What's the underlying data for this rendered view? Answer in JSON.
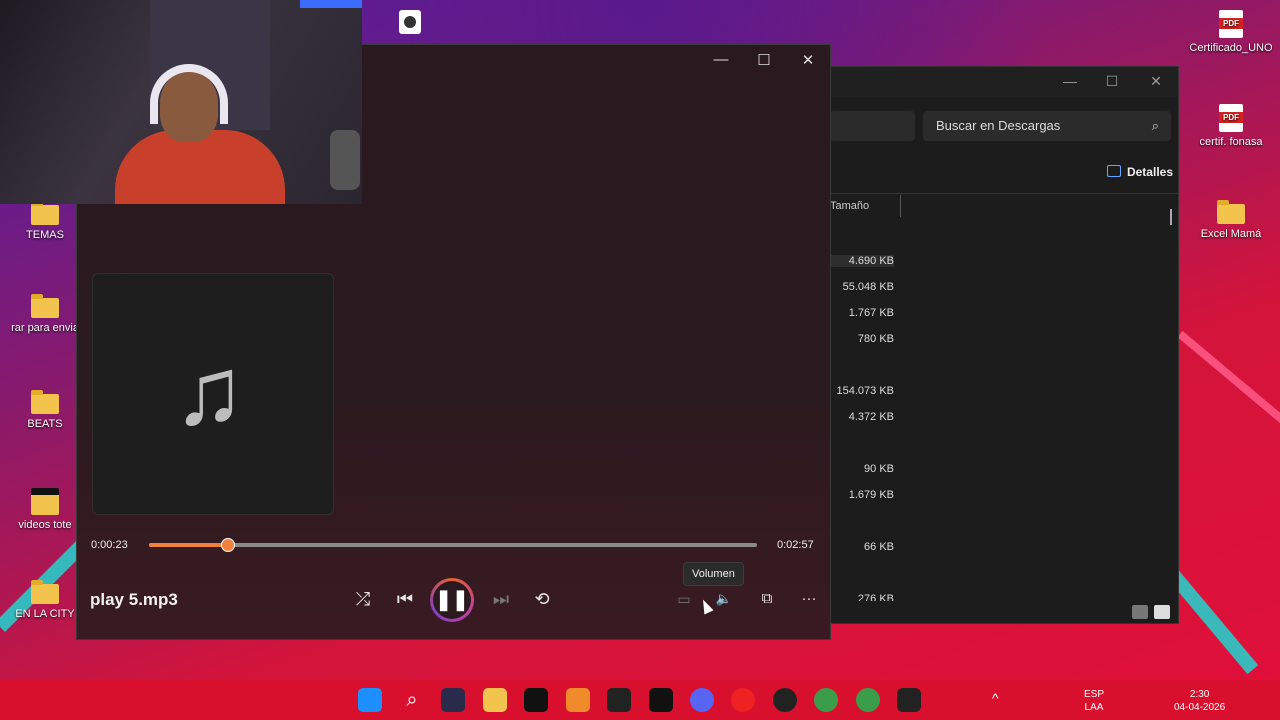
{
  "desktop": {
    "icons_left": [
      {
        "label": "TEMAS",
        "type": "folder"
      },
      {
        "label": "rar para envia",
        "type": "folder"
      },
      {
        "label": "BEATS",
        "type": "folder"
      },
      {
        "label": "videos tote",
        "type": "dark-folder"
      },
      {
        "label": "EN LA CITY",
        "type": "folder"
      }
    ],
    "icons_right": [
      {
        "label": "Certificado_UNO",
        "type": "pdf"
      },
      {
        "label": "certif. fonasa",
        "type": "pdf"
      },
      {
        "label": "Excel Mamá",
        "type": "folder"
      }
    ],
    "pdf_badge": "PDF"
  },
  "explorer": {
    "search_placeholder": "Buscar en Descargas",
    "details_label": "Detalles",
    "column_size": "Tamaño",
    "sizes": [
      "4.690 KB",
      "55.048 KB",
      "1.767 KB",
      "780 KB",
      "154.073 KB",
      "4.372 KB",
      "90 KB",
      "1.679 KB",
      "66 KB",
      "276 KB"
    ],
    "controls": {
      "minimize": "—",
      "maximize": "☐",
      "close": "✕"
    }
  },
  "player": {
    "controls": {
      "minimize": "—",
      "maximize": "☐",
      "close": "✕"
    },
    "current_time": "0:00:23",
    "total_time": "0:02:57",
    "progress_fraction": 0.13,
    "song_title": "play 5.mp3",
    "tooltip": "Volumen",
    "icons": {
      "shuffle": "⤮",
      "previous": "⏮",
      "pause": "❚❚",
      "next": "⏭",
      "repeat": "⟲",
      "miniplayer": "▭",
      "volume": "🔈",
      "cast": "⧉",
      "more": "···",
      "note": "♫"
    },
    "accent_color": "#f0803c"
  },
  "taskbar": {
    "language_top": "ESP",
    "language_bottom": "LAA",
    "time": "2:30",
    "date": "04-04-2026",
    "search_icon": "⌕",
    "chevron": "^"
  }
}
